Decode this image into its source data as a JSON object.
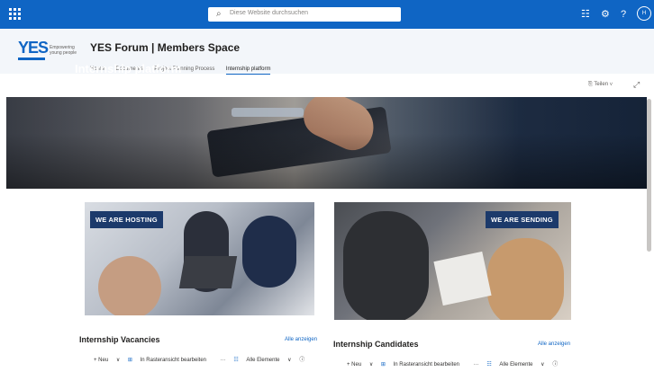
{
  "suite": {
    "search_placeholder": "Diese Website durchsuchen",
    "avatar_initials": "H"
  },
  "site": {
    "logo_text": "YES",
    "tagline": "Empowering young people",
    "title": "YES Forum | Members Space",
    "nav": [
      "Home",
      "Documents",
      "Project Planning Process",
      "Internship platform"
    ],
    "active_nav": "Internship platform"
  },
  "page_commands": {
    "share_label": "Teilen"
  },
  "hero": {
    "title": "Internship platform"
  },
  "cards": {
    "hosting_label": "WE ARE HOSTING",
    "sending_label": "WE ARE SENDING"
  },
  "vacancies": {
    "title": "Internship Vacancies",
    "see_all": "Alle anzeigen",
    "new_label": "Neu",
    "grid_edit_label": "In Rasteransicht bearbeiten",
    "more_label": "···",
    "view_label": "Alle Elemente"
  },
  "candidates": {
    "title": "Internship Candidates",
    "see_all": "Alle anzeigen",
    "new_label": "Neu",
    "grid_edit_label": "In Rasteransicht bearbeiten",
    "more_label": "···",
    "view_label": "Alle Elemente"
  },
  "icons": {
    "waffle": "app-launcher-icon",
    "search": "search-icon",
    "teams": "teams-icon",
    "settings": "gear-icon",
    "help": "help-icon",
    "expand": "expand-icon",
    "info": "info-icon"
  },
  "colors": {
    "suite_bar": "#0f65c4",
    "badge": "#1c3a6b",
    "link": "#0f65c4"
  }
}
